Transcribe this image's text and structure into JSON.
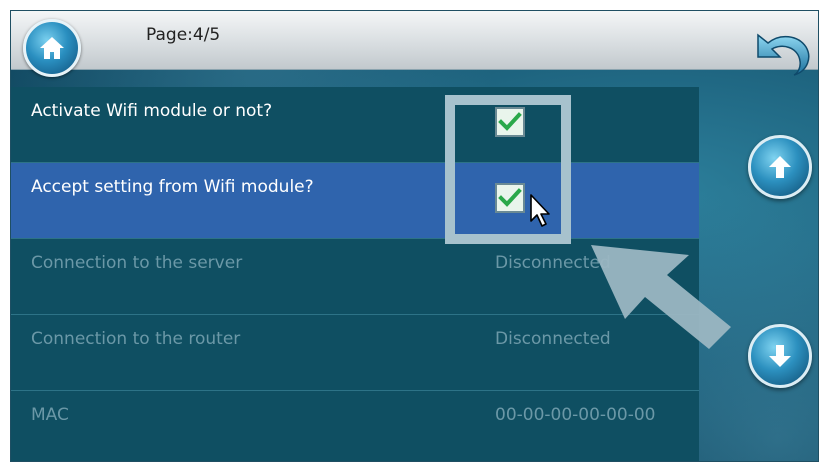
{
  "header": {
    "page_label": "Page:4/5"
  },
  "icons": {
    "home": "home-icon",
    "back": "undo-arrow-icon",
    "up": "arrow-up-icon",
    "down": "arrow-down-icon",
    "check": "checkmark-icon"
  },
  "colors": {
    "row_bg": "#0f4f62",
    "selected_bg": "#2f64ad",
    "check": "#2aa84a",
    "highlight": "#a7c2cd"
  },
  "settings": [
    {
      "label": "Activate Wifi module or not?",
      "checked": true
    },
    {
      "label": "Accept setting from Wifi module?",
      "checked": true
    },
    {
      "label": "Connection to the server",
      "value": "Disconnected"
    },
    {
      "label": "Connection to the router",
      "value": "Disconnected"
    },
    {
      "label": "MAC",
      "value": "00-00-00-00-00-00"
    }
  ]
}
